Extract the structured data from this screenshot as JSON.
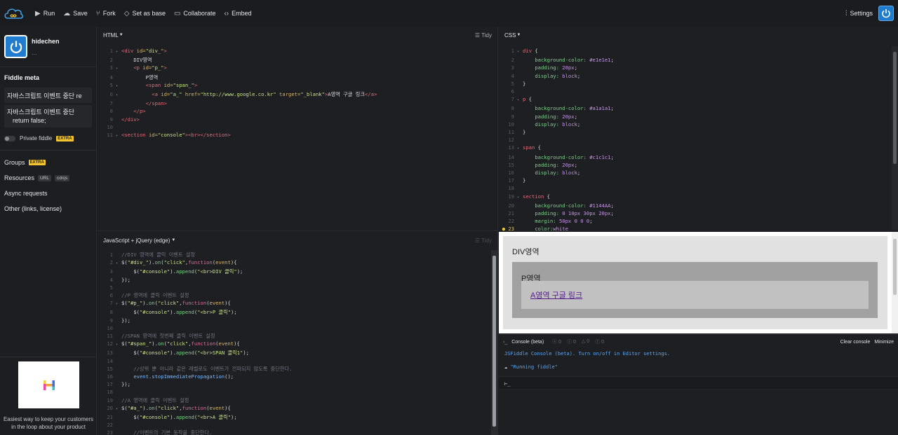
{
  "toolbar": {
    "run": "Run",
    "save": "Save",
    "fork": "Fork",
    "set_as_base": "Set as base",
    "collaborate": "Collaborate",
    "embed": "Embed",
    "settings": "Settings"
  },
  "sidebar": {
    "username": "hidechen",
    "user_sub": "...",
    "meta_title": "Fiddle meta",
    "title_value": "자바스크립트 이벤트 중단     re",
    "description_line1": "자바스크립트 이벤트 중단",
    "description_line2": "return false;",
    "private_label": "Private fiddle",
    "extra_badge": "EXTRA",
    "groups": "Groups",
    "resources": "Resources",
    "url_tag": "URL",
    "cdnjs_tag": "cdnjs",
    "async": "Async requests",
    "other": "Other (links, license)",
    "ad_text": "Easiest way to keep your customers in the loop about your product"
  },
  "panels": {
    "html_label": "HTML",
    "css_label": "CSS",
    "js_label": "JavaScript + jQuery (edge)",
    "tidy": "Tidy"
  },
  "result": {
    "div_text": "DIV영역",
    "p_text": "P영역",
    "link_text": "A영역 구글 링크"
  },
  "console": {
    "title": "Console (beta)",
    "count_errors": "0",
    "count_warnings": "0",
    "count_info": "0",
    "count_logs": "0",
    "clear": "Clear console",
    "minimize": "Minimize",
    "info_line": "JSFiddle Console (beta). Turn on/off in Editor settings.",
    "running_line": "\"Running fiddle\"",
    "prompt": "⊢_"
  },
  "colors": {
    "accent": "#1f7ccf",
    "extra_badge": "#f4c431",
    "div_bg": "#e1e1e1",
    "p_bg": "#a1a1a1",
    "span_bg": "#c1c1c1"
  }
}
